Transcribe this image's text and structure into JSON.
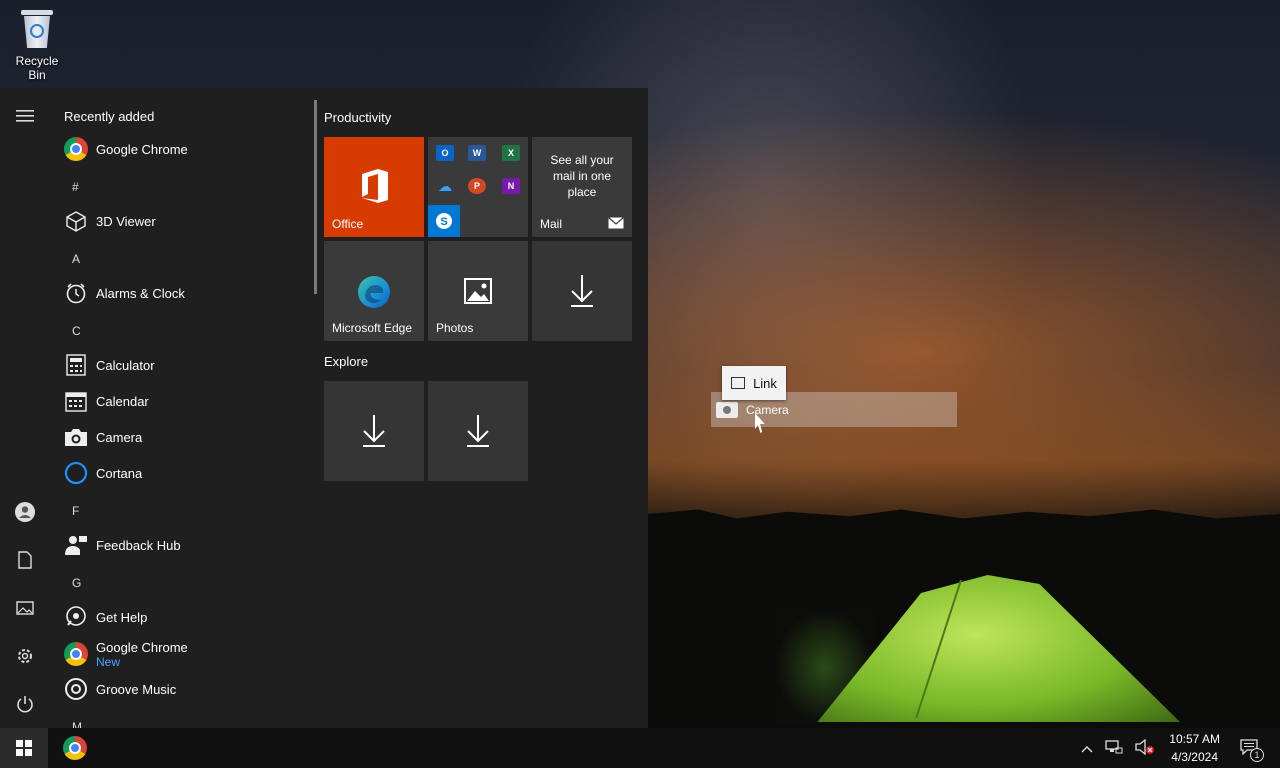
{
  "desktop": {
    "recycle_bin_label": "Recycle Bin"
  },
  "start_menu": {
    "rail_icons": [
      "hamburger-icon",
      "user-icon",
      "documents-icon",
      "pictures-icon",
      "settings-icon",
      "power-icon"
    ],
    "recently_added_label": "Recently added",
    "apps": {
      "recent_chrome": "Google Chrome",
      "g_hash": "#",
      "viewer3d": "3D Viewer",
      "g_a": "A",
      "alarms": "Alarms & Clock",
      "g_c": "C",
      "calculator": "Calculator",
      "calendar": "Calendar",
      "camera": "Camera",
      "cortana": "Cortana",
      "g_f": "F",
      "feedback": "Feedback Hub",
      "g_g": "G",
      "gethelp": "Get Help",
      "chrome2": "Google Chrome",
      "chrome2_sub": "New",
      "groove": "Groove Music",
      "g_m": "M"
    },
    "productivity_title": "Productivity",
    "explore_title": "Explore",
    "tiles": {
      "office": "Office",
      "mail_text": "See all your mail in one place",
      "mail": "Mail",
      "edge": "Microsoft Edge",
      "photos": "Photos"
    }
  },
  "drag": {
    "tooltip": "Link",
    "ghost_label": "Camera"
  },
  "taskbar": {
    "time": "10:57 AM",
    "date": "4/3/2024",
    "notification_count": "1"
  },
  "colors": {
    "office": "#d83b01",
    "skype": "#0078d4",
    "accent_link": "#4aa3ff"
  }
}
